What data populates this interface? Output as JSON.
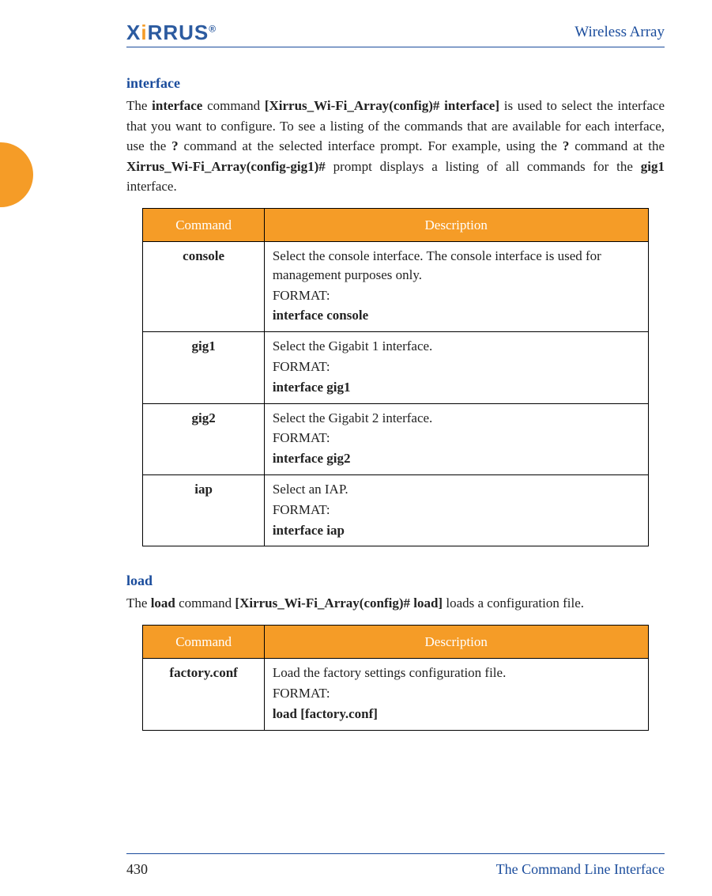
{
  "logo_text_pre": "X",
  "logo_text_post": "RRUS",
  "logo_reg": "®",
  "doc_title": "Wireless Array",
  "section1": {
    "heading": "interface",
    "para_parts": {
      "t0": "The ",
      "t1": "interface",
      "t2": " command ",
      "t3": "[Xirrus_Wi-Fi_Array(config)# interface]",
      "t4": " is used to select the interface that you want to configure. To see a listing of the commands that are available for each interface, use the ",
      "t5": "?",
      "t6": " command at the selected interface prompt. For example, using the ",
      "t7": "?",
      "t8": " command at the ",
      "t9": "Xirrus_Wi-Fi_Array(config-gig1)#",
      "t10": " prompt displays a listing of all commands for the ",
      "t11": "gig1",
      "t12": " interface."
    },
    "table": {
      "h1": "Command",
      "h2": "Description",
      "rows": [
        {
          "cmd": "console",
          "d1": "Select the console interface. The console interface is used for management purposes only.",
          "d2": "FORMAT:",
          "d3": "interface console"
        },
        {
          "cmd": "gig1",
          "d1": "Select the Gigabit 1 interface.",
          "d2": "FORMAT:",
          "d3": "interface gig1"
        },
        {
          "cmd": "gig2",
          "d1": "Select the Gigabit 2 interface.",
          "d2": "FORMAT:",
          "d3": "interface gig2"
        },
        {
          "cmd": "iap",
          "d1": "Select an IAP.",
          "d2": "FORMAT:",
          "d3": "interface iap"
        }
      ]
    }
  },
  "section2": {
    "heading": "load",
    "para_parts": {
      "t0": "The ",
      "t1": "load",
      "t2": " command ",
      "t3": "[Xirrus_Wi-Fi_Array(config)# load]",
      "t4": " loads a configuration file."
    },
    "table": {
      "h1": "Command",
      "h2": "Description",
      "rows": [
        {
          "cmd": "factory.conf",
          "d1": "Load the factory settings configuration file.",
          "d2": "FORMAT:",
          "d3": "load [factory.conf]"
        }
      ]
    }
  },
  "footer": {
    "page": "430",
    "chapter": "The Command Line Interface"
  }
}
